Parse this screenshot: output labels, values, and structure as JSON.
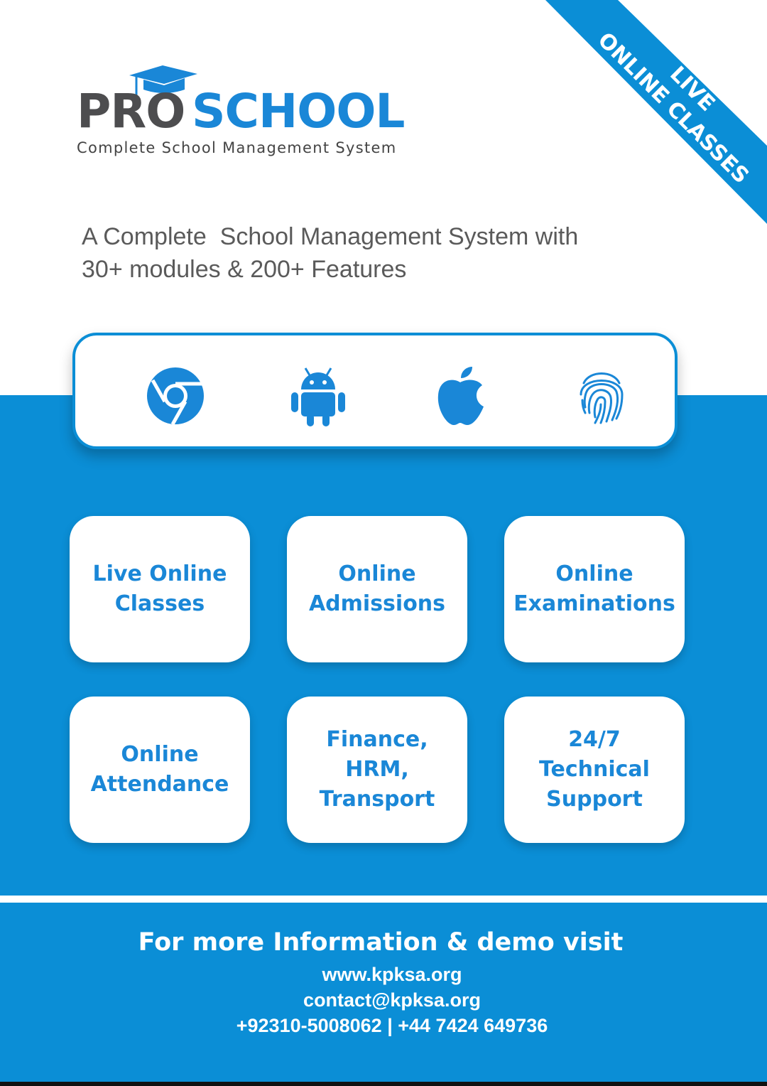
{
  "brand": {
    "name_part1": "PRO",
    "name_part2": "SCHOOL",
    "tagline": "Complete School Management System",
    "primary_color": "#0b8ed6",
    "text_gray": "#4d4d4f"
  },
  "ribbon": {
    "line1": "LIVE",
    "line2": "ONLINE CLASSES"
  },
  "headline": {
    "line1": "A Complete  School Management System with",
    "line2": "30+ modules & 200+ Features"
  },
  "platforms": [
    {
      "icon": "chrome-icon"
    },
    {
      "icon": "android-icon"
    },
    {
      "icon": "apple-icon"
    },
    {
      "icon": "fingerprint-icon"
    }
  ],
  "features": [
    {
      "label": "Live Online\nClasses"
    },
    {
      "label": "Online\nAdmissions"
    },
    {
      "label": "Online\nExaminations"
    },
    {
      "label": "Online\nAttendance"
    },
    {
      "label": "Finance,\nHRM,\nTransport"
    },
    {
      "label": "24/7\nTechnical\nSupport"
    }
  ],
  "footer": {
    "title": "For more Information & demo visit",
    "website": "www.kpksa.org",
    "email": "contact@kpksa.org",
    "phones": "+92310-5008062 | +44 7424 649736"
  }
}
